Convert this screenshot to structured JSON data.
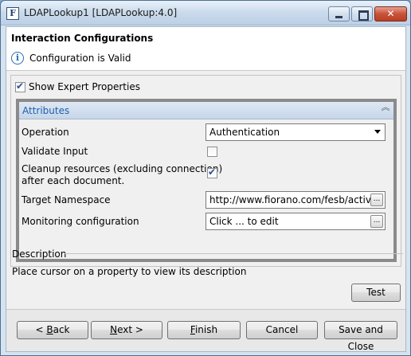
{
  "window": {
    "icon_letter": "F",
    "title": "LDAPLookup1 [LDAPLookup:4.0]",
    "close_glyph": "✕"
  },
  "header": {
    "title": "Interaction Configurations",
    "status": "Configuration is Valid",
    "status_icon": "info-icon"
  },
  "expert": {
    "label": "Show Expert Properties",
    "checked": true
  },
  "attributes": {
    "title": "Attributes",
    "collapse_glyph": "⌃⌃",
    "properties": [
      {
        "label": "Operation",
        "type": "combo",
        "value": "Authentication"
      },
      {
        "label": "Validate Input",
        "type": "checkbox",
        "checked": false
      },
      {
        "label": "Cleanup resources (excluding connection)",
        "label2": "after each document.",
        "type": "checkbox",
        "checked": true
      },
      {
        "label": "Target Namespace",
        "type": "text",
        "value": "http://www.fiorano.com/fesb/activit"
      },
      {
        "label": "Monitoring configuration",
        "type": "text",
        "value": "Click ... to edit"
      }
    ],
    "ellipsis": "..."
  },
  "description": {
    "title": "Description",
    "text": "Place cursor on a property to view its description"
  },
  "buttons": {
    "test": "Test",
    "back_mn": "B",
    "back_prefix": "< ",
    "back_rest": "ack",
    "next_mn": "N",
    "next_rest": "ext >",
    "finish_mn": "F",
    "finish_rest": "inish",
    "cancel": "Cancel",
    "save_close": "Save and Close"
  }
}
